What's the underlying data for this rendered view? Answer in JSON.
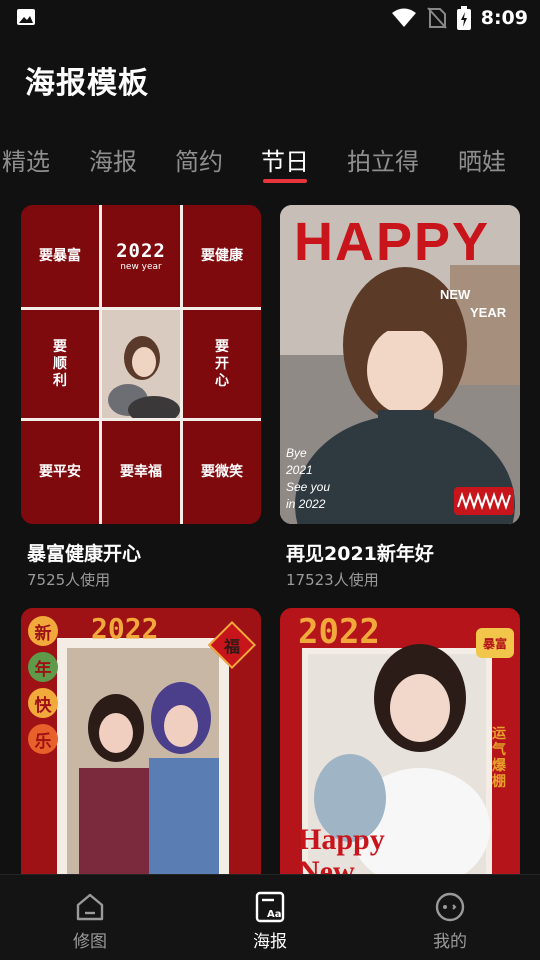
{
  "status_bar": {
    "time": "8:09",
    "icons": [
      "image-icon",
      "wifi-icon",
      "no-sim-icon",
      "battery-charging-icon"
    ]
  },
  "page_title": "海报模板",
  "tabs": [
    {
      "label": "精选",
      "active": false
    },
    {
      "label": "海报",
      "active": false
    },
    {
      "label": "简约",
      "active": false
    },
    {
      "label": "节日",
      "active": true
    },
    {
      "label": "拍立得",
      "active": false
    },
    {
      "label": "晒娃",
      "active": false
    }
  ],
  "templates": [
    {
      "title": "暴富健康开心",
      "usage": "7525人使用",
      "poster_text": {
        "year": "2022",
        "subtitle": "new year",
        "cells": [
          "要暴富",
          "要健康",
          "要\n顺\n利",
          "要\n开\n心",
          "要平安",
          "要幸福",
          "要微笑"
        ]
      }
    },
    {
      "title": "再见2021新年好",
      "usage": "17523人使用",
      "poster_text": {
        "headline": "HAPPY",
        "sub1": "NEW",
        "sub2": "YEAR",
        "note": [
          "Bye",
          "2021",
          "See you",
          "in 2022"
        ]
      }
    },
    {
      "title": "",
      "usage": "",
      "poster_text": {
        "year": "2022",
        "side": [
          "新",
          "年",
          "快",
          "乐"
        ],
        "fu": "福"
      }
    },
    {
      "title": "",
      "usage": "",
      "poster_text": {
        "year": "2022",
        "badge": "暴富",
        "side": "运气爆棚",
        "bottom": "Happy New"
      }
    }
  ],
  "bottom_nav": [
    {
      "label": "修图",
      "icon": "home-icon",
      "active": false
    },
    {
      "label": "海报",
      "icon": "poster-icon",
      "active": true
    },
    {
      "label": "我的",
      "icon": "profile-icon",
      "active": false
    }
  ],
  "colors": {
    "accent": "#e8343c",
    "background": "#111111",
    "poster_red": "#7e0a0e"
  }
}
